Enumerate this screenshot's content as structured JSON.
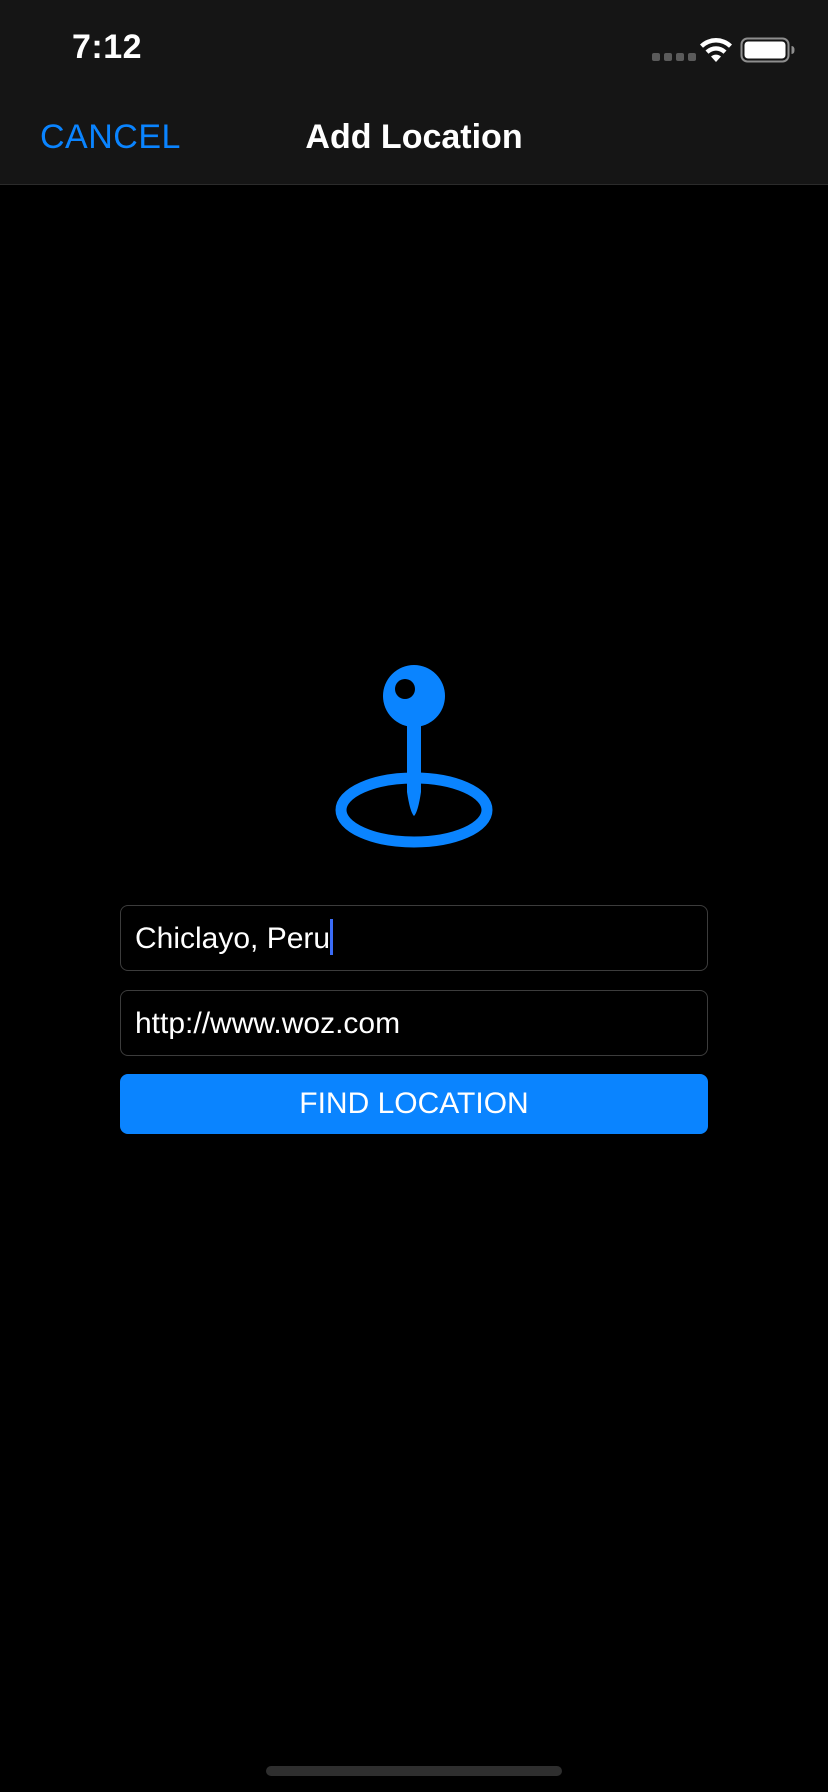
{
  "status_bar": {
    "time": "7:12",
    "wifi_icon": "wifi-icon",
    "battery_icon": "battery-icon"
  },
  "nav": {
    "cancel_label": "CANCEL",
    "title": "Add Location"
  },
  "pin": {
    "icon": "location-pin-icon",
    "color": "#0a84ff"
  },
  "form": {
    "location_value": "Chiclayo, Peru",
    "url_value": "http://www.woz.com",
    "find_button_label": "FIND LOCATION"
  },
  "colors": {
    "accent": "#0a84ff",
    "background": "#000000",
    "header": "#151515"
  }
}
